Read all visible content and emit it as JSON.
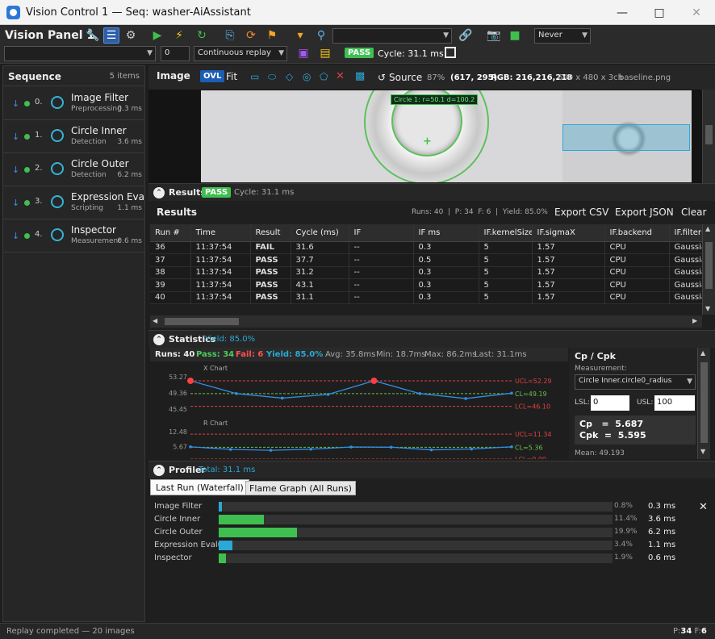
{
  "window": {
    "title": "Vision Control 1 — Seq: washer-AiAssistant"
  },
  "toolbar": {
    "panel_title": "Vision Panel 1",
    "search_value": "",
    "never_label": "Never",
    "field_value": "0",
    "replay_mode": "Continuous replay",
    "status_badge": "PASS",
    "cycle_text": "Cycle: 31.1 ms"
  },
  "sequence": {
    "title": "Sequence",
    "count": "5 items",
    "items": [
      {
        "index": "0.",
        "name": "Image Filter",
        "type": "Preprocessing",
        "time": "0.3 ms"
      },
      {
        "index": "1.",
        "name": "Circle Inner",
        "type": "Detection",
        "time": "3.6 ms"
      },
      {
        "index": "2.",
        "name": "Circle Outer",
        "type": "Detection",
        "time": "6.2 ms"
      },
      {
        "index": "3.",
        "name": "Expression Evaluator",
        "type": "Scripting",
        "time": "1.1 ms"
      },
      {
        "index": "4.",
        "name": "Inspector",
        "type": "Measurement",
        "time": "0.6 ms"
      }
    ]
  },
  "image": {
    "title": "Image",
    "ovl": "OVL",
    "fit": "Fit",
    "source": "Source",
    "zoom": "87%",
    "coords": "(617, 295)",
    "rgb": "RGB: 216,216,218",
    "dims": "640 x 480 x 3ch",
    "file": "baseline.png",
    "overlay_label": "Circle 1: r=50.1 d=100.2"
  },
  "results_bar": {
    "title": "Results",
    "badge": "PASS",
    "cycle": "Cycle: 31.1 ms"
  },
  "results": {
    "title": "Results",
    "summary": "Runs: 40  |  P: 34  F: 6  |  Yield: 85.0%",
    "export_csv": "Export CSV",
    "export_json": "Export JSON",
    "clear": "Clear",
    "columns": [
      "Run #",
      "Time",
      "Result",
      "Cycle (ms)",
      "IF",
      "IF ms",
      "IF.kernelSize",
      "IF.sigmaX",
      "IF.backend",
      "IF.filter"
    ],
    "rows": [
      [
        "36",
        "11:37:54",
        "FAIL",
        "31.6",
        "--",
        "0.3",
        "5",
        "1.57",
        "CPU",
        "Gaussian"
      ],
      [
        "37",
        "11:37:54",
        "PASS",
        "37.7",
        "--",
        "0.5",
        "5",
        "1.57",
        "CPU",
        "Gaussian"
      ],
      [
        "38",
        "11:37:54",
        "PASS",
        "31.2",
        "--",
        "0.3",
        "5",
        "1.57",
        "CPU",
        "Gaussian"
      ],
      [
        "39",
        "11:37:54",
        "PASS",
        "43.1",
        "--",
        "0.3",
        "5",
        "1.57",
        "CPU",
        "Gaussian"
      ],
      [
        "40",
        "11:37:54",
        "PASS",
        "31.1",
        "--",
        "0.3",
        "5",
        "1.57",
        "CPU",
        "Gaussian"
      ]
    ]
  },
  "statistics": {
    "title": "Statistics",
    "yield": "Yield: 85.0%",
    "runs": "Runs: 40",
    "pass": "Pass: 34",
    "fail": "Fail: 6",
    "yield2": "Yield: 85.0%",
    "avg": "Avg: 35.8ms",
    "min": "Min: 18.7ms",
    "max": "Max: 86.2ms",
    "last": "Last: 31.1ms",
    "cp_title": "Cp / Cpk",
    "measurement_label": "Measurement:",
    "measurement_value": "Circle Inner.circle0_radius",
    "lsl_label": "LSL:",
    "lsl_value": "0",
    "usl_label": "USL:",
    "usl_value": "100",
    "cp": "Cp   =  5.687",
    "cpk": "Cpk  =  5.595",
    "mean": "Mean: 49.193"
  },
  "chart_data": [
    {
      "type": "line",
      "title": "X Chart",
      "y_ticks": [
        "53.27",
        "49.36",
        "45.45"
      ],
      "ylim": [
        45.45,
        53.27
      ],
      "limits": {
        "ucl": 52.29,
        "cl": 49.19,
        "lcl": 46.1
      },
      "limit_labels": [
        "UCL=52.29",
        "CL=49.19",
        "LCL=46.10"
      ],
      "values": [
        52.3,
        49.2,
        48.1,
        49.0,
        52.3,
        49.2,
        48.0,
        49.3
      ],
      "out_of_control": [
        0,
        4
      ],
      "colors": {
        "line": "#2f8fe0",
        "ucl": "#e04040",
        "cl": "#6ac04a",
        "point_fail": "#ff4040"
      }
    },
    {
      "type": "line",
      "title": "R Chart",
      "y_ticks": [
        "12.48",
        "5.67"
      ],
      "ylim": [
        0,
        12.48
      ],
      "limits": {
        "ucl": 11.34,
        "cl": 5.36,
        "lcl": 0.0
      },
      "limit_labels": [
        "UCL=11.34",
        "CL=5.36",
        "LCL=0.00"
      ],
      "values": [
        5.6,
        4.4,
        4.0,
        4.5,
        5.5,
        5.4,
        4.2,
        4.6,
        5.6
      ],
      "colors": {
        "line": "#2f8fe0",
        "ucl": "#e04040",
        "cl": "#6ac04a"
      }
    }
  ],
  "profiler": {
    "title": "Profiler",
    "total": "Total: 31.1 ms",
    "tab_waterfall": "Last Run (Waterfall)",
    "tab_flame": "Flame Graph (All Runs)",
    "rows": [
      {
        "label": "Image Filter",
        "start": 0.0,
        "fraction": 0.008,
        "pct": "0.8%",
        "ms": "0.3 ms",
        "color": "#2aa9d6"
      },
      {
        "label": "Circle Inner",
        "start": 0.0,
        "fraction": 0.114,
        "pct": "11.4%",
        "ms": "3.6 ms",
        "color": "#3fbf4f"
      },
      {
        "label": "Circle Outer",
        "start": 0.0,
        "fraction": 0.199,
        "pct": "19.9%",
        "ms": "6.2 ms",
        "color": "#3fbf4f"
      },
      {
        "label": "Expression Evaluator",
        "start": 0.0,
        "fraction": 0.034,
        "pct": "3.4%",
        "ms": "1.1 ms",
        "color": "#2aa9d6"
      },
      {
        "label": "Inspector",
        "start": 0.0,
        "fraction": 0.019,
        "pct": "1.9%",
        "ms": "0.6 ms",
        "color": "#3fbf4f"
      }
    ]
  },
  "status": {
    "text": "Replay completed — 20 images",
    "p_label": "P:",
    "p": "34",
    "f_label": "F:",
    "f": "6"
  }
}
